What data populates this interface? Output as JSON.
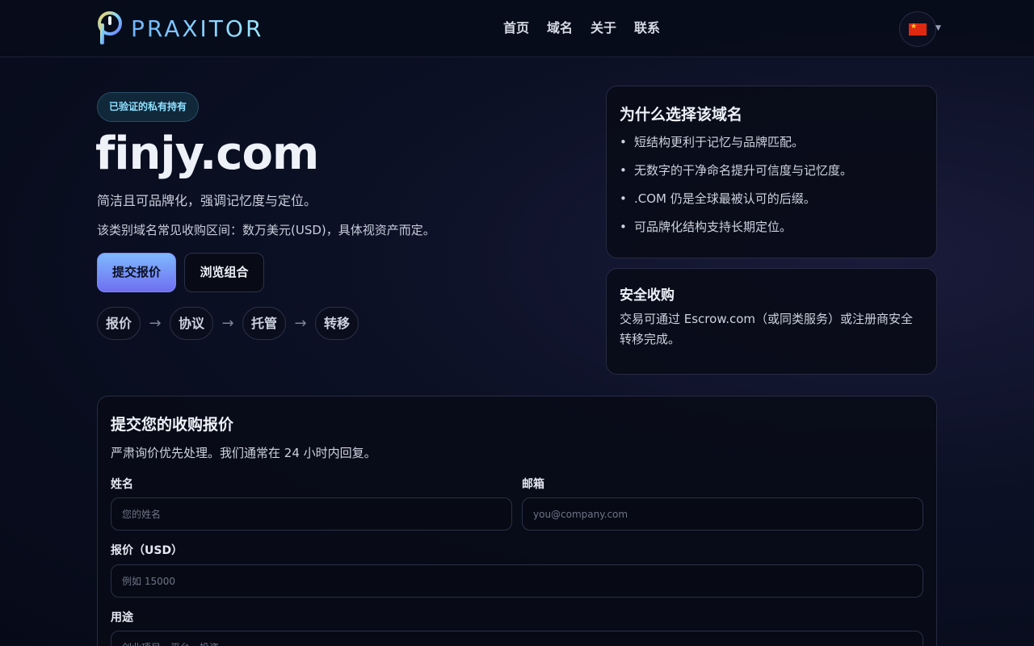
{
  "header": {
    "brand": "PRAXITOR",
    "nav": [
      "首页",
      "域名",
      "关于",
      "联系"
    ],
    "language": "CN flag"
  },
  "hero": {
    "badge": "已验证的私有持有",
    "domain": "finjy.com",
    "tagline": "简洁且可品牌化，强调记忆度与定位。",
    "price_range": "该类别域名常见收购区间：数万美元(USD)，具体视资产而定。",
    "primary_button": "提交报价",
    "secondary_button": "浏览组合",
    "steps": [
      "报价",
      "协议",
      "托管",
      "转移"
    ]
  },
  "why": {
    "title": "为什么选择该域名",
    "items": [
      "短结构更利于记忆与品牌匹配。",
      "无数字的干净命名提升可信度与记忆度。",
      ".COM 仍是全球最被认可的后缀。",
      "可品牌化结构支持长期定位。"
    ]
  },
  "safe": {
    "title": "安全收购",
    "text": "交易可通过 Escrow.com（或同类服务）或注册商安全转移完成。"
  },
  "form": {
    "title": "提交您的收购报价",
    "subtitle": "严肃询价优先处理。我们通常在 24 小时内回复。",
    "name_label": "姓名",
    "name_placeholder": "您的姓名",
    "email_label": "邮箱",
    "email_placeholder": "you@company.com",
    "offer_label": "报价（USD）",
    "offer_placeholder": "例如 15000",
    "purpose_label": "用途",
    "purpose_placeholder": "创业项目、平台、投资"
  },
  "colors": {
    "accent_cyan": "#8fe0ff",
    "button_gradient_start": "#7fb9ff",
    "button_gradient_end": "#6f6ff0",
    "background": "#0b1024"
  }
}
